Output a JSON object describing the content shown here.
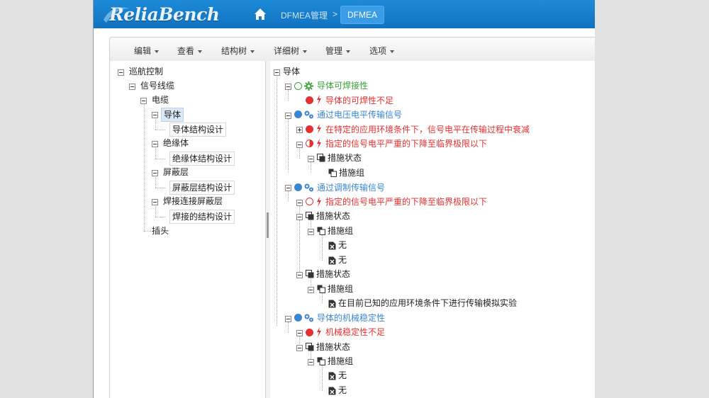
{
  "app": {
    "logo_text": "ReliaBench",
    "breadcrumb": {
      "parent": "DFMEA管理",
      "separator": ">",
      "current": "DFMEA"
    }
  },
  "menu": [
    {
      "label": "编辑"
    },
    {
      "label": "查看"
    },
    {
      "label": "结构树"
    },
    {
      "label": "详细树"
    },
    {
      "label": "管理"
    },
    {
      "label": "选项"
    }
  ],
  "structure_tree": [
    {
      "label": "巡航控制",
      "toggle": "minus"
    },
    {
      "label": "信号线缆",
      "toggle": "minus"
    },
    {
      "label": "电缆",
      "toggle": "minus"
    },
    {
      "label": "导体",
      "toggle": "minus",
      "selected": true
    },
    {
      "label": "导体结构设计"
    },
    {
      "label": "绝缘体",
      "toggle": "minus"
    },
    {
      "label": "绝缘体结构设计"
    },
    {
      "label": "屏蔽层",
      "toggle": "minus"
    },
    {
      "label": "屏蔽层结构设计"
    },
    {
      "label": "焊接连接屏蔽层",
      "toggle": "minus"
    },
    {
      "label": "焊接的结构设计"
    },
    {
      "label": "插头"
    }
  ],
  "detail_tree": [
    {
      "label": "导体",
      "kind": "root"
    },
    {
      "label": "导体可焊接性",
      "kind": "function-green"
    },
    {
      "label": "导体的可焊性不足",
      "kind": "failure-red"
    },
    {
      "label": "通过电压电平传输信号",
      "kind": "function-blue"
    },
    {
      "label": "在特定的应用环境条件下，信号电平在传输过程中衰减",
      "kind": "failure-red"
    },
    {
      "label": "指定的信号电平严重的下降至临界极限以下",
      "kind": "failure-half"
    },
    {
      "label": "措施状态",
      "kind": "measure-state"
    },
    {
      "label": "措施组",
      "kind": "measure-group"
    },
    {
      "label": "通过调制传输信号",
      "kind": "function-blue"
    },
    {
      "label": "指定的信号电平严重的下降至临界极限以下",
      "kind": "failure-empty"
    },
    {
      "label": "措施状态",
      "kind": "measure-state"
    },
    {
      "label": "措施组",
      "kind": "measure-group"
    },
    {
      "label": "无",
      "kind": "measure-item"
    },
    {
      "label": "无",
      "kind": "measure-item"
    },
    {
      "label": "措施状态",
      "kind": "measure-state"
    },
    {
      "label": "措施组",
      "kind": "measure-group"
    },
    {
      "label": "在目前已知的应用环境条件下进行传输模拟实验",
      "kind": "measure-item"
    },
    {
      "label": "导体的机械稳定性",
      "kind": "function-blue"
    },
    {
      "label": "机械稳定性不足",
      "kind": "failure-red"
    },
    {
      "label": "措施状态",
      "kind": "measure-state"
    },
    {
      "label": "措施组",
      "kind": "measure-group"
    },
    {
      "label": "无",
      "kind": "measure-item"
    },
    {
      "label": "无",
      "kind": "measure-item"
    }
  ],
  "colors": {
    "navbar": "#1172c0",
    "failure": "#e53030",
    "function_ok": "#3aa13a",
    "function": "#3a86d0",
    "selected": "#dbe9f7"
  }
}
